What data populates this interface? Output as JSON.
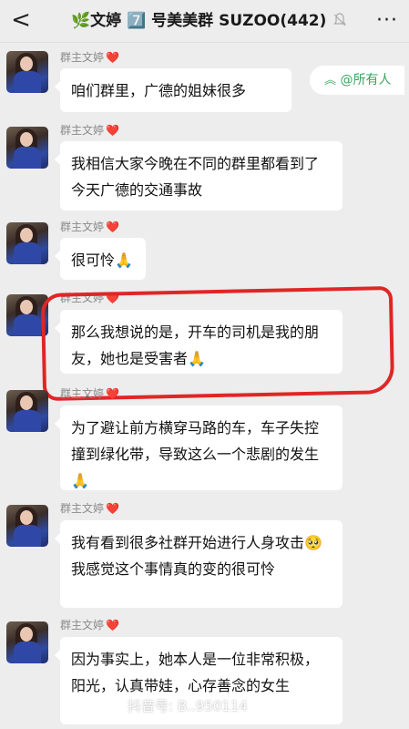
{
  "header": {
    "back": "<",
    "title": "🌿文婷 7️⃣ 号美美群 SUZOO(442)",
    "mute_icon": "muted-bell-icon",
    "more": "···"
  },
  "mention_chip": {
    "label": "@所有人",
    "icon": "double-chevron-up-icon"
  },
  "messages": [
    {
      "sender": "群主文婷",
      "heart": "❤️",
      "text": "咱们群里，广德的姐妹很多"
    },
    {
      "sender": "群主文婷",
      "heart": "❤️",
      "text": "我相信大家今晚在不同的群里都看到了今天广德的交通事故"
    },
    {
      "sender": "群主文婷",
      "heart": "❤️",
      "text": "很可怜🙏"
    },
    {
      "sender": "群主文婷",
      "heart": "❤️",
      "text": "那么我想说的是，开车的司机是我的朋友，她也是受害者🙏"
    },
    {
      "sender": "群主文婷",
      "heart": "❤️",
      "text": "为了避让前方横穿马路的车，车子失控撞到绿化带，导致这么一个悲剧的发生🙏"
    },
    {
      "sender": "群主文婷",
      "heart": "❤️",
      "text": "我有看到很多社群开始进行人身攻击🥺我感觉这个事情真的变的很可怜"
    },
    {
      "sender": "群主文婷",
      "heart": "❤️",
      "text": "因为事实上，她本人是一位非常积极，阳光，认真带娃，心存善念的女生"
    }
  ],
  "watermark": "抖音号: B..950114"
}
